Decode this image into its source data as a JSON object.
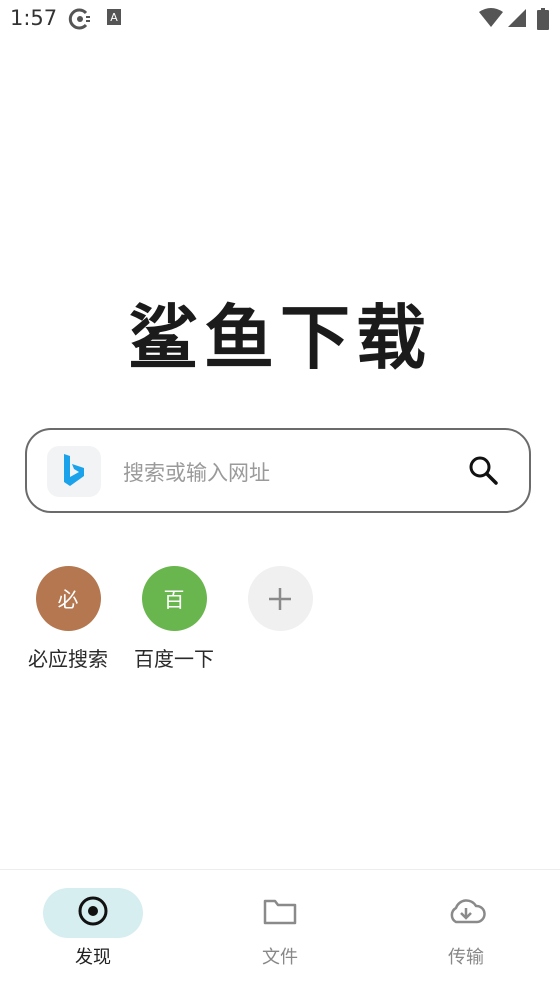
{
  "status_bar": {
    "time": "1:57",
    "left_icons": [
      "sync-icon",
      "text-a-icon"
    ],
    "right_icons": [
      "wifi-icon",
      "signal-icon",
      "battery-icon"
    ]
  },
  "app": {
    "logo_text": "鲨鱼下载"
  },
  "search": {
    "engine_icon": "bing-icon",
    "placeholder": "搜索或输入网址",
    "value": "",
    "button_icon": "search-icon"
  },
  "shortcuts": [
    {
      "initial": "必",
      "label": "必应搜索",
      "color": "#b4774f"
    },
    {
      "initial": "百",
      "label": "百度一下",
      "color": "#69b64e"
    },
    {
      "icon": "plus-icon",
      "label": "",
      "color": "#f0f0f0"
    }
  ],
  "bottom_nav": [
    {
      "label": "发现",
      "icon": "discover-icon",
      "active": true
    },
    {
      "label": "文件",
      "icon": "folder-icon",
      "active": false
    },
    {
      "label": "传输",
      "icon": "cloud-download-icon",
      "active": false
    }
  ],
  "colors": {
    "active_pill": "#d6eef0",
    "bing_blue": "#1aa3ea",
    "search_border": "#6b6b6b"
  }
}
